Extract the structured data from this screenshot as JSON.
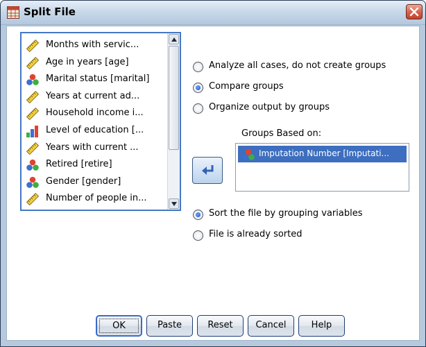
{
  "window": {
    "title": "Split File",
    "app_icon": "spreadsheet-icon",
    "close_icon": "close-icon"
  },
  "variables": {
    "items": [
      {
        "label": "Months with servic...",
        "icon": "ruler-icon"
      },
      {
        "label": "Age in years [age]",
        "icon": "ruler-icon"
      },
      {
        "label": "Marital status [marital]",
        "icon": "nominal-icon"
      },
      {
        "label": "Years at current ad...",
        "icon": "ruler-icon"
      },
      {
        "label": "Household income i...",
        "icon": "ruler-icon"
      },
      {
        "label": "Level of education [...",
        "icon": "ordinal-icon"
      },
      {
        "label": "Years with current ...",
        "icon": "ruler-icon"
      },
      {
        "label": "Retired [retire]",
        "icon": "nominal-icon"
      },
      {
        "label": "Gender [gender]",
        "icon": "nominal-icon"
      },
      {
        "label": "Number of people in...",
        "icon": "ruler-icon"
      }
    ]
  },
  "options": {
    "analyze_all": "Analyze all cases, do not create groups",
    "compare": "Compare groups",
    "organize": "Organize output by groups",
    "selected": "compare"
  },
  "groups": {
    "label": "Groups Based on:",
    "items": [
      {
        "label": "Imputation Number [Imputati...",
        "icon": "nominal-icon"
      }
    ]
  },
  "sort": {
    "sort_label": "Sort the file by grouping variables",
    "already_label": "File is already sorted",
    "selected": "sort"
  },
  "buttons": {
    "ok": "OK",
    "paste": "Paste",
    "reset": "Reset",
    "cancel": "Cancel",
    "help": "Help"
  },
  "colors": {
    "accent": "#3d6ebf",
    "title_bar": "#c9d9ea",
    "close": "#d9634c"
  }
}
